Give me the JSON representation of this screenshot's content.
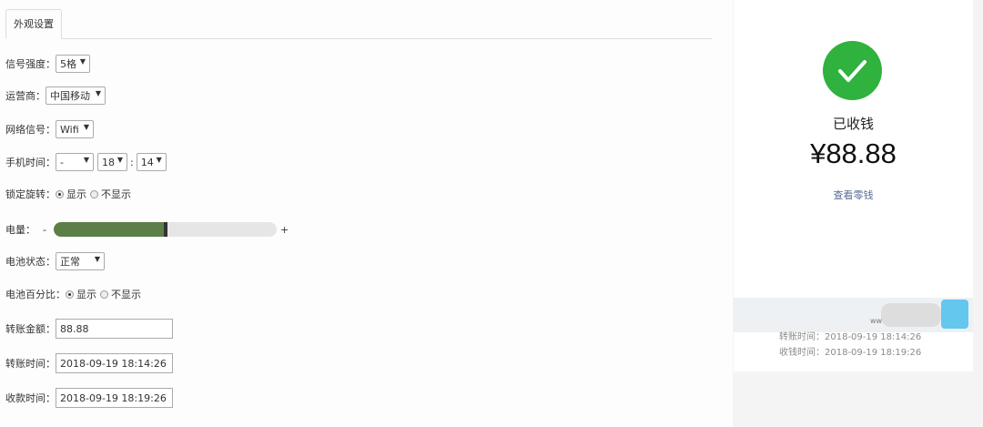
{
  "tab": {
    "label": "外观设置"
  },
  "settings": {
    "signal_label": "信号强度：",
    "signal_value": "5格",
    "carrier_label": "运营商：",
    "carrier_value": "中国移动",
    "network_label": "网络信号：",
    "network_value": "Wifi",
    "time_label": "手机时间：",
    "time_prefix": "-",
    "time_hour": "18",
    "time_sep": ":",
    "time_minute": "14",
    "lock_label": "锁定旋转：",
    "lock_show": "显示",
    "lock_hide": "不显示",
    "battery_label": "电量：",
    "battery_minus": "-",
    "battery_plus": "+",
    "battery_level": 0.5,
    "battery_status_label": "电池状态：",
    "battery_status_value": "正常",
    "battery_pct_label": "电池百分比：",
    "battery_pct_show": "显示",
    "battery_pct_hide": "不显示",
    "amount_label": "转账金额：",
    "amount_value": "88.88",
    "transfer_time_label": "转账时间：",
    "transfer_time_value": "2018-09-19 18:14:26",
    "receive_time_label": "收款时间：",
    "receive_time_value": "2018-09-19 18:19:26"
  },
  "preview": {
    "status": "已收钱",
    "amount": "¥88.88",
    "change_link": "查看零钱",
    "blur_text": "ww",
    "transfer_line": "转账时间：2018-09-19 18:14:26",
    "receive_line": "收钱时间：2018-09-19 18:19:26",
    "accent_color": "#2fb23e"
  }
}
